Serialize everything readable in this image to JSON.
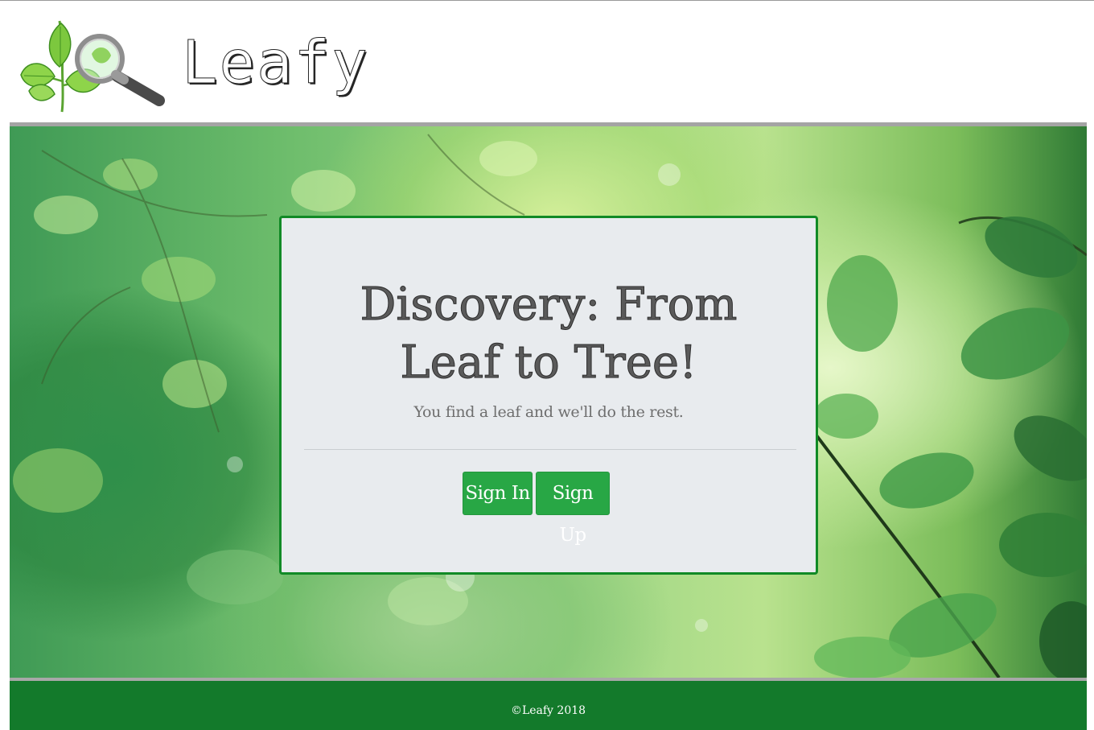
{
  "header": {
    "logo_text": "Leafy"
  },
  "card": {
    "title": "Discovery: From Leaf to Tree!",
    "subtitle": "You find a leaf and we'll do the rest.",
    "sign_in_label": "Sign In",
    "sign_up_label": "Sign Up"
  },
  "footer": {
    "copyright": "©Leafy 2018"
  },
  "colors": {
    "card_border": "#118a26",
    "button": "#28a745",
    "footer": "#137a2b"
  },
  "icons": {
    "logo": "leaf-magnifier-icon"
  }
}
